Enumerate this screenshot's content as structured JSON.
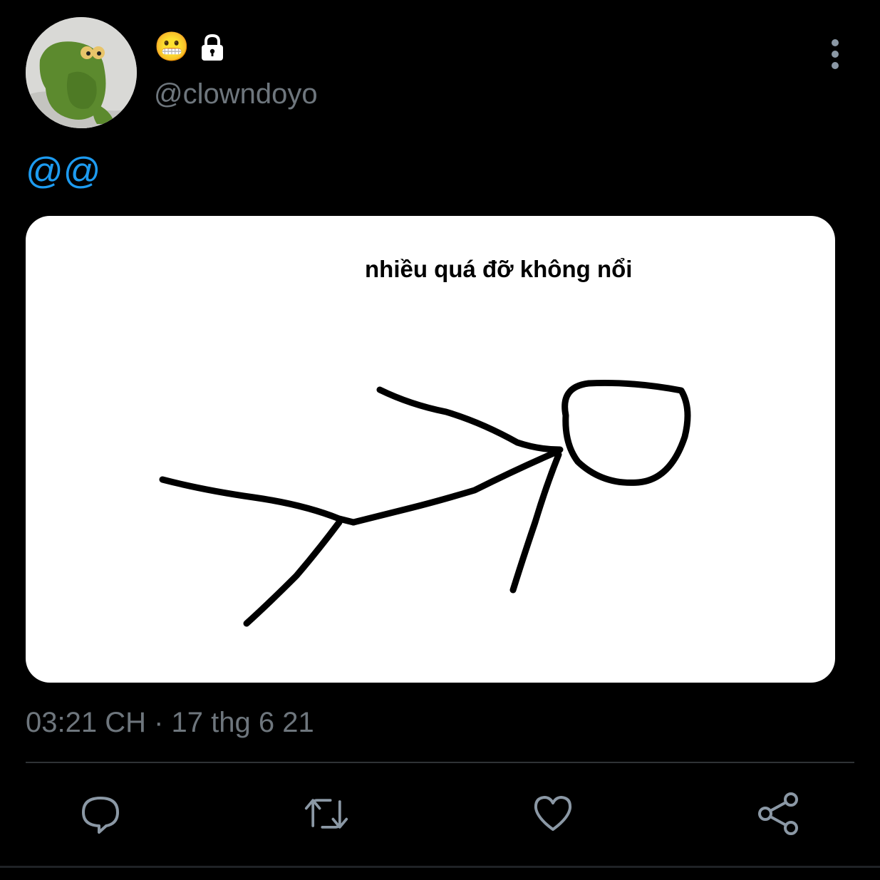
{
  "user": {
    "display_emoji": "😬",
    "locked_icon": "lock-icon",
    "handle": "@clowndoyo",
    "avatar_icon": "kermit-avatar"
  },
  "tweet": {
    "text": "@@",
    "media_caption": "nhiều quá đỡ không nổi",
    "timestamp": "03:21 CH · 17 thg 6 21"
  },
  "actions": [
    {
      "icon": "reply-icon"
    },
    {
      "icon": "retweet-icon"
    },
    {
      "icon": "like-icon"
    },
    {
      "icon": "share-icon"
    }
  ],
  "colors": {
    "background": "#000000",
    "accent": "#1d9bf0",
    "secondary_text": "#6e767d",
    "divider": "#2f3336",
    "icon": "#8b98a5"
  }
}
